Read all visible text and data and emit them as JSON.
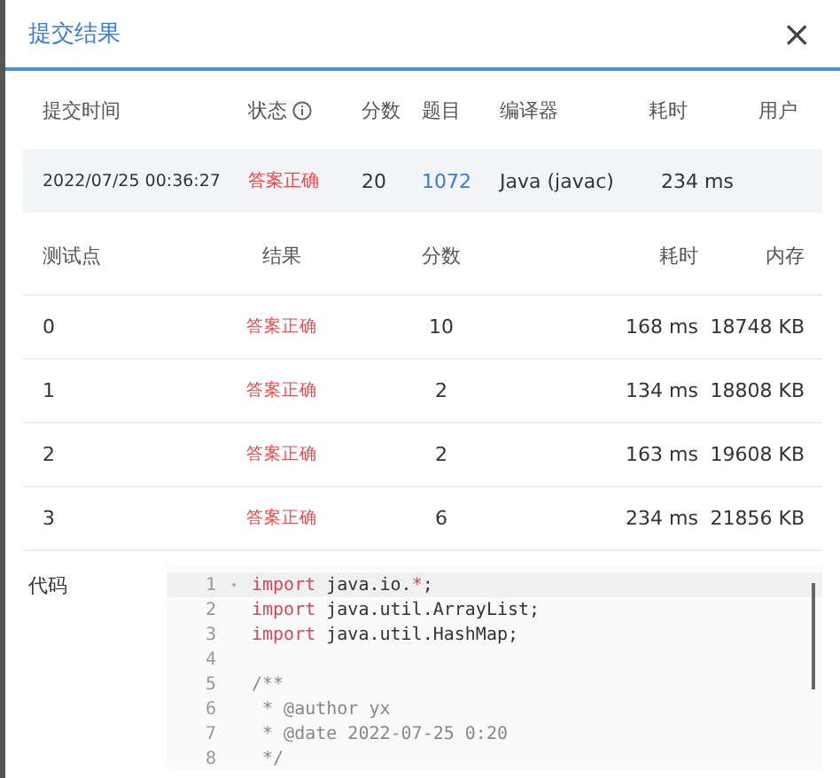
{
  "dialog": {
    "title": "提交结果",
    "close": "×"
  },
  "submission": {
    "columns": [
      "提交时间",
      "状态",
      "分数",
      "题目",
      "编译器",
      "耗时",
      "用户"
    ],
    "row": {
      "time": "2022/07/25 00:36:27",
      "status": "答案正确",
      "score": "20",
      "problem": "1072",
      "compiler": "Java (javac)",
      "duration": "234 ms"
    }
  },
  "tests": {
    "columns": [
      "测试点",
      "结果",
      "分数",
      "耗时",
      "内存"
    ],
    "rows": [
      {
        "case": "0",
        "result": "答案正确",
        "score": "10",
        "duration": "168 ms",
        "memory": "18748 KB"
      },
      {
        "case": "1",
        "result": "答案正确",
        "score": "2",
        "duration": "134 ms",
        "memory": "18808 KB"
      },
      {
        "case": "2",
        "result": "答案正确",
        "score": "2",
        "duration": "163 ms",
        "memory": "19608 KB"
      },
      {
        "case": "3",
        "result": "答案正确",
        "score": "6",
        "duration": "234 ms",
        "memory": "21856 KB"
      }
    ]
  },
  "code": {
    "label": "代码",
    "lines": [
      {
        "number": "1",
        "selected": true,
        "segments": [
          {
            "text": "import",
            "kind": "keyword"
          },
          {
            "text": " java.io.",
            "kind": "plain"
          },
          {
            "text": "*",
            "kind": "keyword"
          },
          {
            "text": ";",
            "kind": "plain"
          }
        ]
      },
      {
        "number": "2",
        "selected": false,
        "segments": [
          {
            "text": "import",
            "kind": "keyword"
          },
          {
            "text": " java.util.ArrayList;",
            "kind": "plain"
          }
        ]
      },
      {
        "number": "3",
        "selected": false,
        "segments": [
          {
            "text": "import",
            "kind": "keyword"
          },
          {
            "text": " java.util.HashMap;",
            "kind": "plain"
          }
        ]
      },
      {
        "number": "4",
        "selected": false
      },
      {
        "number": "5",
        "selected": false,
        "segments": [
          {
            "text": "/**",
            "kind": "comment"
          }
        ]
      },
      {
        "number": "6",
        "selected": false,
        "segments": [
          {
            "text": " * @author yx",
            "kind": "comment"
          }
        ]
      },
      {
        "number": "7",
        "selected": false,
        "segments": [
          {
            "text": " * @date 2022-07-25 0:20",
            "kind": "comment"
          }
        ]
      },
      {
        "number": "8",
        "selected": false,
        "segments": [
          {
            "text": " */",
            "kind": "comment"
          }
        ]
      }
    ]
  }
}
